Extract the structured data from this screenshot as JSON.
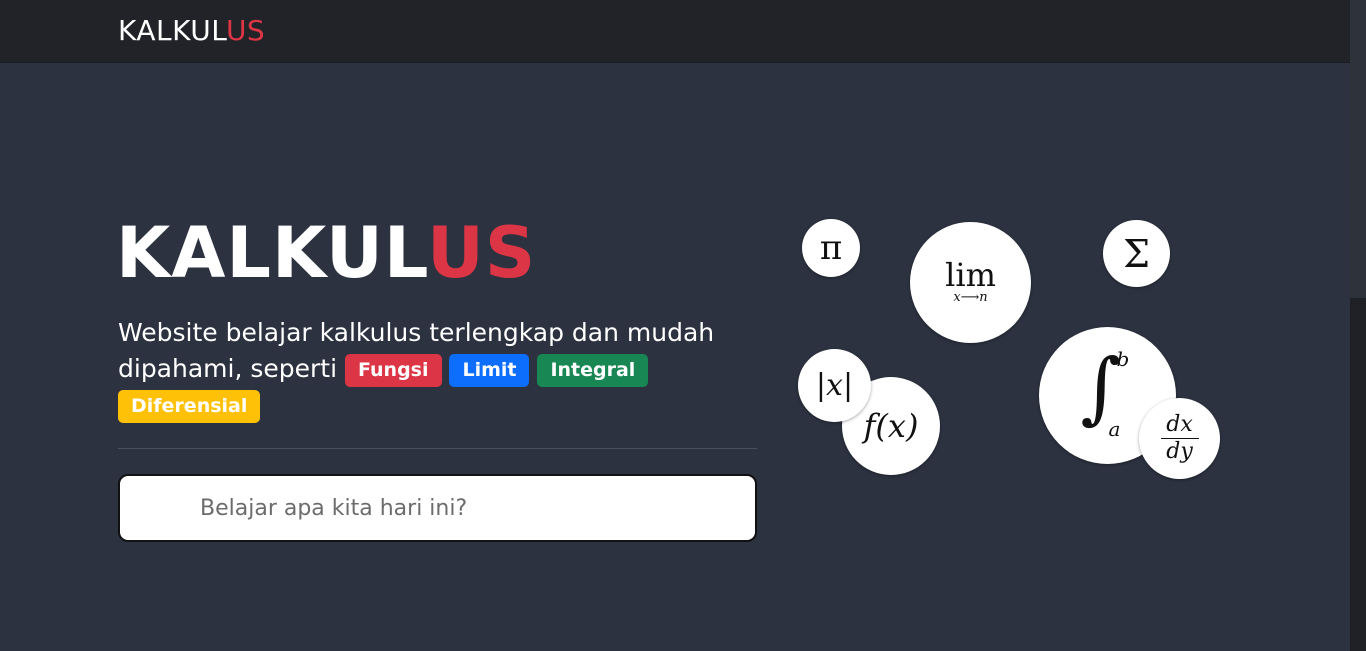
{
  "navbar": {
    "brand_main": "KALKUL",
    "brand_accent": "US"
  },
  "hero": {
    "title_main": "KALKUL",
    "title_accent": "US",
    "lead_text": "Website belajar kalkulus terlengkap dan mudah dipahami, seperti",
    "badges": [
      {
        "label": "Fungsi",
        "color": "#dc3545"
      },
      {
        "label": "Limit",
        "color": "#0d6efd"
      },
      {
        "label": "Integral",
        "color": "#198754"
      },
      {
        "label": "Diferensial",
        "color": "#ffc107"
      }
    ]
  },
  "search": {
    "placeholder": "Belajar apa kita hari ini?"
  },
  "symbols": {
    "pi": "π",
    "lim_top": "lim",
    "lim_sub": "x⟶n",
    "sigma": "Σ",
    "abs": "|x|",
    "fx": "f(x)",
    "int_sign": "∫",
    "int_upper": "b",
    "int_lower": "a",
    "deriv_num": "dx",
    "deriv_den": "dy"
  },
  "colors": {
    "accent": "#dc3545",
    "background": "#2c3240",
    "navbar": "#212328"
  }
}
